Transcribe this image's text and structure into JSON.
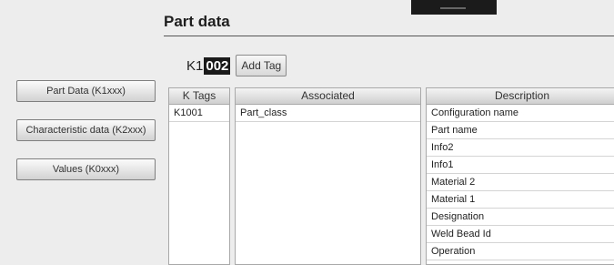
{
  "header": {
    "title": "Part data"
  },
  "tag_entry": {
    "prefix": "K1",
    "value": "002",
    "add_label": "Add Tag"
  },
  "sidebar": {
    "buttons": [
      {
        "label": "Part Data (K1xxx)"
      },
      {
        "label": "Characteristic data (K2xxx)"
      },
      {
        "label": "Values (K0xxx)"
      }
    ]
  },
  "tables": {
    "k_tags": {
      "header": "K Tags",
      "rows": [
        "K1001"
      ]
    },
    "associated": {
      "header": "Associated",
      "rows": [
        "Part_class"
      ]
    },
    "description": {
      "header": "Description",
      "rows": [
        "Configuration name",
        "Part name",
        "Info2",
        "Info1",
        "Material 2",
        "Material 1",
        "Designation",
        "Weld Bead Id",
        "Operation"
      ]
    }
  }
}
